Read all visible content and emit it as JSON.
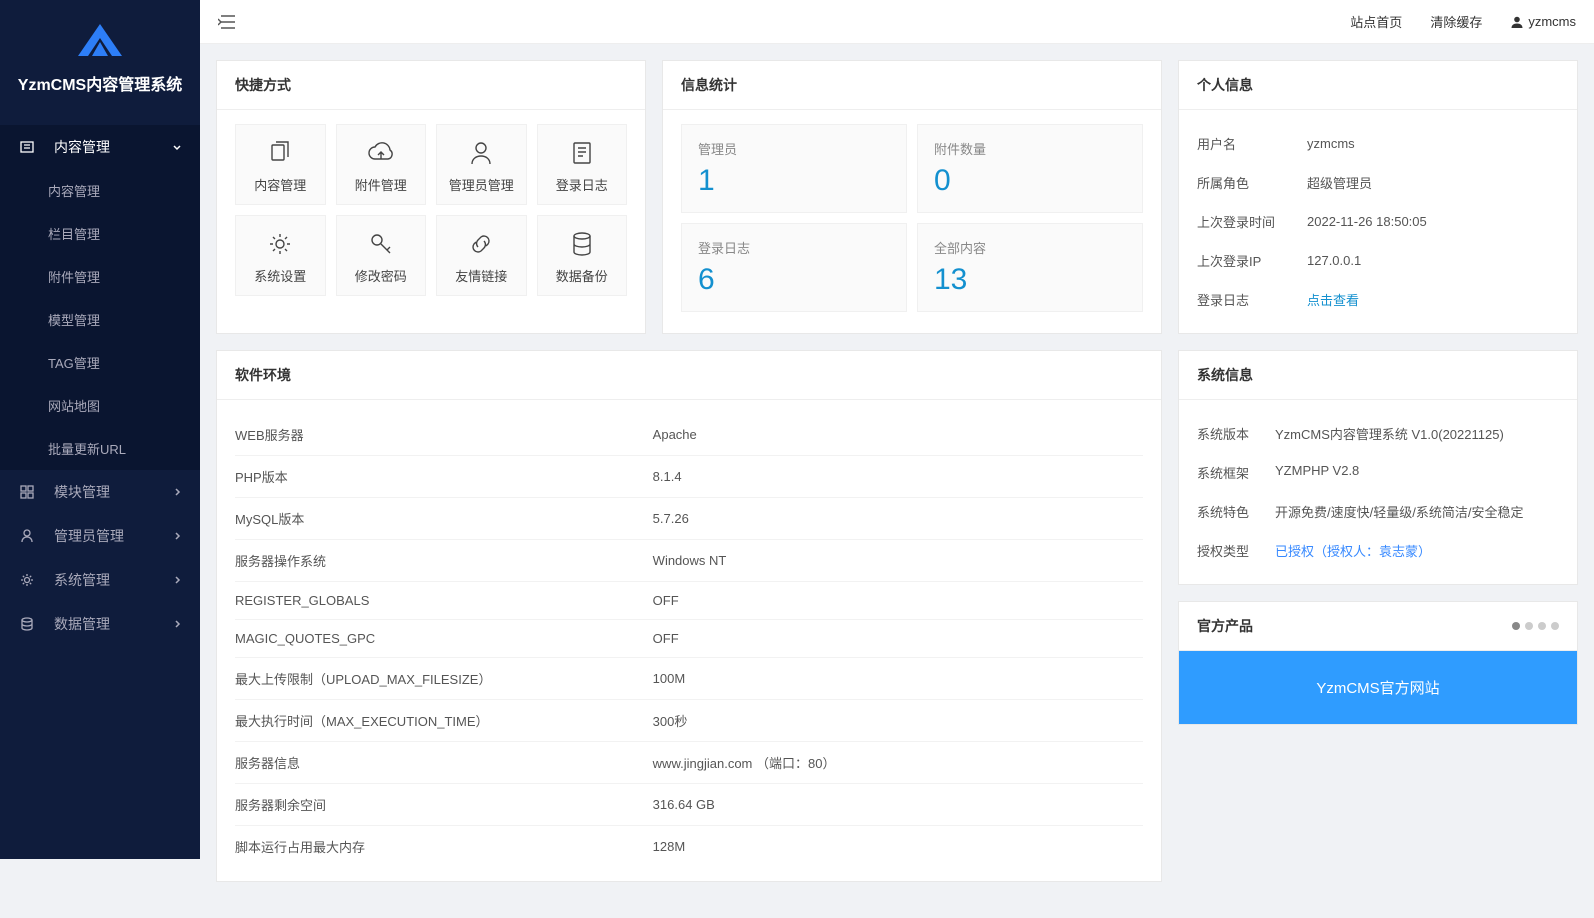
{
  "brand": {
    "name": "YzmCMS内容管理系统"
  },
  "header": {
    "links": {
      "home": "站点首页",
      "clear_cache": "清除缓存"
    },
    "username": "yzmcms"
  },
  "sidebar": {
    "items": [
      {
        "label": "内容管理",
        "icon": "content",
        "expanded": true,
        "children": [
          {
            "label": "内容管理"
          },
          {
            "label": "栏目管理"
          },
          {
            "label": "附件管理"
          },
          {
            "label": "模型管理"
          },
          {
            "label": "TAG管理"
          },
          {
            "label": "网站地图"
          },
          {
            "label": "批量更新URL"
          }
        ]
      },
      {
        "label": "模块管理",
        "icon": "module"
      },
      {
        "label": "管理员管理",
        "icon": "admin"
      },
      {
        "label": "系统管理",
        "icon": "system"
      },
      {
        "label": "数据管理",
        "icon": "data"
      }
    ]
  },
  "shortcuts": {
    "title": "快捷方式",
    "items": [
      {
        "label": "内容管理",
        "icon": "copy"
      },
      {
        "label": "附件管理",
        "icon": "cloud"
      },
      {
        "label": "管理员管理",
        "icon": "user"
      },
      {
        "label": "登录日志",
        "icon": "log"
      },
      {
        "label": "系统设置",
        "icon": "gear"
      },
      {
        "label": "修改密码",
        "icon": "key"
      },
      {
        "label": "友情链接",
        "icon": "link"
      },
      {
        "label": "数据备份",
        "icon": "db"
      }
    ]
  },
  "stats": {
    "title": "信息统计",
    "items": [
      {
        "label": "管理员",
        "value": "1"
      },
      {
        "label": "附件数量",
        "value": "0"
      },
      {
        "label": "登录日志",
        "value": "6"
      },
      {
        "label": "全部内容",
        "value": "13"
      }
    ]
  },
  "personal": {
    "title": "个人信息",
    "rows": [
      {
        "k": "用户名",
        "v": "yzmcms"
      },
      {
        "k": "所属角色",
        "v": "超级管理员"
      },
      {
        "k": "上次登录时间",
        "v": "2022-11-26 18:50:05"
      },
      {
        "k": "上次登录IP",
        "v": "127.0.0.1"
      },
      {
        "k": "登录日志",
        "v": "点击查看",
        "link": true
      }
    ]
  },
  "software": {
    "title": "软件环境",
    "rows": [
      {
        "k": "WEB服务器",
        "v": "Apache"
      },
      {
        "k": "PHP版本",
        "v": "8.1.4"
      },
      {
        "k": "MySQL版本",
        "v": "5.7.26"
      },
      {
        "k": "服务器操作系统",
        "v": "Windows NT"
      },
      {
        "k": "REGISTER_GLOBALS",
        "v": "OFF"
      },
      {
        "k": "MAGIC_QUOTES_GPC",
        "v": "OFF"
      },
      {
        "k": "最大上传限制（UPLOAD_MAX_FILESIZE）",
        "v": "100M"
      },
      {
        "k": "最大执行时间（MAX_EXECUTION_TIME）",
        "v": "300秒"
      },
      {
        "k": "服务器信息",
        "v": "www.jingjian.com （端口：80）"
      },
      {
        "k": "服务器剩余空间",
        "v": "316.64 GB"
      },
      {
        "k": "脚本运行占用最大内存",
        "v": "128M"
      }
    ]
  },
  "sysinfo": {
    "title": "系统信息",
    "rows": [
      {
        "k": "系统版本",
        "v": "YzmCMS内容管理系统 V1.0(20221125)"
      },
      {
        "k": "系统框架",
        "v": "YZMPHP V2.8"
      },
      {
        "k": "系统特色",
        "v": "开源免费/速度快/轻量级/系统简洁/安全稳定"
      },
      {
        "k": "授权类型",
        "v": "已授权（授权人：袁志蒙）",
        "link": true
      }
    ]
  },
  "products": {
    "title": "官方产品",
    "banner": "YzmCMS官方网站"
  }
}
